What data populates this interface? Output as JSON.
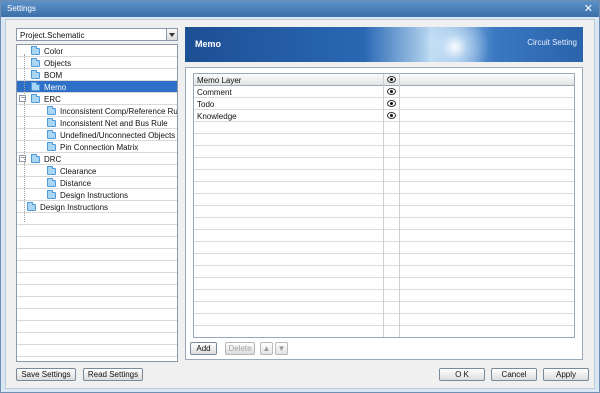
{
  "window": {
    "title": "Settings",
    "close_icon": "close-icon"
  },
  "project": {
    "selected": "Project.Schematic"
  },
  "tree": {
    "items": [
      {
        "label": "Color",
        "level": 1,
        "icon": "folder-icon"
      },
      {
        "label": "Objects",
        "level": 1,
        "icon": "folder-icon"
      },
      {
        "label": "BOM",
        "level": 1,
        "icon": "folder-icon"
      },
      {
        "label": "Memo",
        "level": 1,
        "icon": "folder-icon",
        "selected": true
      },
      {
        "label": "ERC",
        "level": 1,
        "icon": "folder-icon",
        "expander": "−"
      },
      {
        "label": "Inconsistent Comp/Reference Rule",
        "level": 2,
        "icon": "folder-icon"
      },
      {
        "label": "Inconsistent Net and Bus Rule",
        "level": 2,
        "icon": "folder-icon"
      },
      {
        "label": "Undefined/Unconnected Objects",
        "level": 2,
        "icon": "folder-icon"
      },
      {
        "label": "Pin Connection Matrix",
        "level": 2,
        "icon": "folder-icon"
      },
      {
        "label": "DRC",
        "level": 1,
        "icon": "folder-icon",
        "expander": "−"
      },
      {
        "label": "Clearance",
        "level": 2,
        "icon": "folder-icon"
      },
      {
        "label": "Distance",
        "level": 2,
        "icon": "folder-icon"
      },
      {
        "label": "Design Instructions",
        "level": 2,
        "icon": "folder-icon"
      },
      {
        "label": "Design Instructions",
        "level": 0,
        "icon": "folder-icon"
      }
    ]
  },
  "left_buttons": {
    "save": "Save Settings",
    "read": "Read Settings"
  },
  "banner": {
    "title": "Memo",
    "subtitle": "Circuit Setting"
  },
  "memo_table": {
    "header": "Memo Layer",
    "visibility_icon": "eye-icon",
    "rows": [
      {
        "name": "Comment"
      },
      {
        "name": "Todo"
      },
      {
        "name": "Knowledge"
      }
    ]
  },
  "table_buttons": {
    "add": "Add",
    "delete": "Delete",
    "up_icon": "arrow-up-icon",
    "down_icon": "arrow-down-icon"
  },
  "dialog_buttons": {
    "ok": "O K",
    "cancel": "Cancel",
    "apply": "Apply"
  }
}
